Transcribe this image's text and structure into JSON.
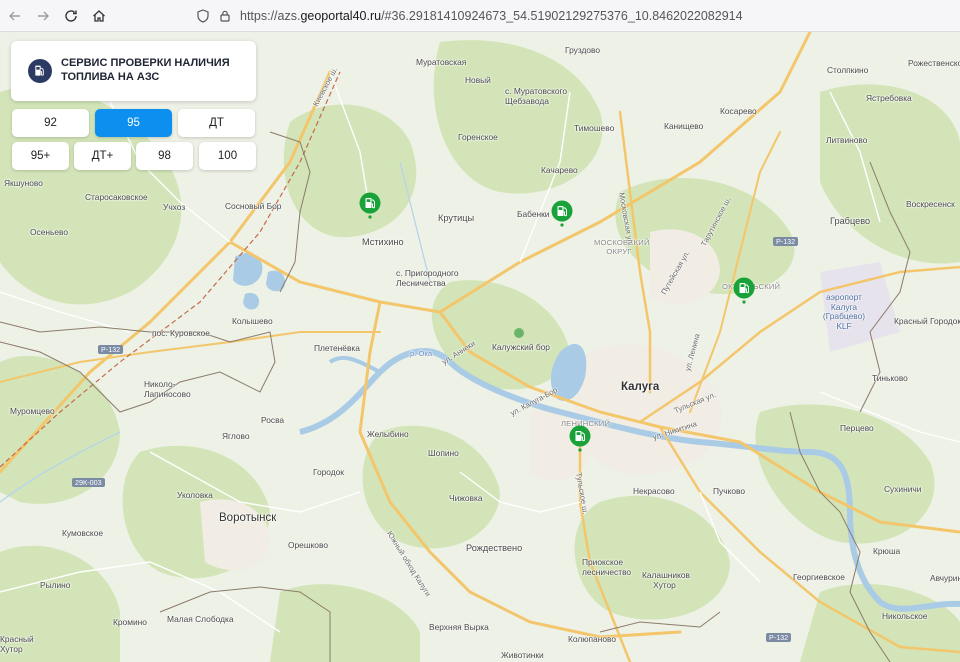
{
  "browser": {
    "url_prefix": "https://azs.",
    "url_host": "geoportal40.ru",
    "url_rest": "/#36.29181410924673_54.51902129275376_10.8462022082914"
  },
  "panel": {
    "title": "СЕРВИС ПРОВЕРКИ НАЛИЧИЯ ТОПЛИВА НА АЗС"
  },
  "fuel_buttons": {
    "row1": [
      "92",
      "95",
      "ДТ"
    ],
    "row2": [
      "95+",
      "ДТ+",
      "98",
      "100"
    ],
    "selected": "95"
  },
  "colors": {
    "accent": "#0d8ff0",
    "marker": "#1aa23a",
    "panel_icon": "#2b3b63",
    "water": "#a9cbe6",
    "forest": "#cfe2b4",
    "roads": "#f3c66b"
  },
  "map_labels": {
    "gruzdovo": "Груздово",
    "stolpkino": "Столпкино",
    "rozhdestvenskoe": "Рожественское",
    "muratovskaya": "Муратовская",
    "novyi": "Новый",
    "muratovsky": "с. Муратовского Щебзавода",
    "kievskoe": "Киевское ш.",
    "yastrebovka": "Ястребовка",
    "gorenskoe": "Горенское",
    "timoshevo": "Тимошево",
    "kanishchevo": "Канищево",
    "kosarevo": "Косарево",
    "litvinovo": "Литвиново",
    "kacharevo": "Качарево",
    "yakshunovo": "Якшуново",
    "starosakovskoe": "Старосаковское",
    "uchoz": "Учхоз",
    "sosnovyi_bor": "Сосновый Бор",
    "babenki": "Бабенки",
    "krutitsy": "Крутицы",
    "osenevo": "Осеньево",
    "mstikhino": "Мстихино",
    "moskovsky_okrug": "МОСКОВСКИЙ ОКРУГ",
    "grabtsevo": "Грабцево",
    "voskresensk": "Воскресенск",
    "prigorodnoe": "с. Пригородного Лесничества",
    "oktyabrsky": "ОКТЯБРЬСКИЙ",
    "airport": "аэропорт Калуга (Грабцево) KLF",
    "kolyshevo": "Колышево",
    "kurovskoe": "пос. Куровское",
    "krasny_gorodok": "Красный Городок",
    "kaluzhsky_bor": "Калужский бор",
    "pletenevka": "Плетенёвка",
    "nikolo_lapinosovo": "Николо-Лапиносово",
    "kaluga": "Калуга",
    "tinkovo": "Тиньково",
    "muromtsevo": "Муромцево",
    "rosva": "Росва",
    "leninsky": "ЛЕНИНСКИЙ",
    "pertsevo": "Перцево",
    "yaglovo": "Яглово",
    "zhelybino": "Желыбино",
    "shopino": "Шопино",
    "gorodok": "Городок",
    "nekrasovo": "Некрасово",
    "puchkovo": "Пучково",
    "sukhinichi": "Сухиничи",
    "ukolovka": "Уколовка",
    "chizhovka": "Чижовка",
    "vorotynsk": "Воротынск",
    "kumovskoe": "Кумовское",
    "oreshkovo": "Орешково",
    "rozhdestveno": "Рождествено",
    "priokskoe": "Приокское лесничество",
    "kryusha": "Крюша",
    "rylino": "Рылино",
    "avchurino": "Авчурин",
    "kalashnikov": "Калашников Хутор",
    "georgievskoe": "Георгиевское",
    "krasnyi_khutor": "Красный Хутор",
    "kromino": "Кромино",
    "malaya_slobodka": "Малая Слободка",
    "verkhnyaya_vyrka": "Верхняя Вырка",
    "kolyupanovo": "Колюпаново",
    "zhivotinki": "Животинки",
    "nikolskoe": "Никольское",
    "tulskaya": "Тульская ул.",
    "ul_kaluga_bor": "ул. Калуга-Бор",
    "ul_anneki": "ул. Аннеки",
    "yuzhny_obhod": "Южный обход Калуги",
    "tarutinskoe": "Тарутинское ш.",
    "putevaya": "Путейская ул.",
    "moskovskaya": "Московская ул.",
    "ul_lenina": "ул. Ленина",
    "ul_nikitina": "ул. Никитина",
    "tulskoe_sh": "Тульское ш.",
    "r132": "Р-132",
    "r132b": "Р-132",
    "r132c": "Р-132",
    "r29k": "29К-003",
    "oka": "р. Ока"
  }
}
